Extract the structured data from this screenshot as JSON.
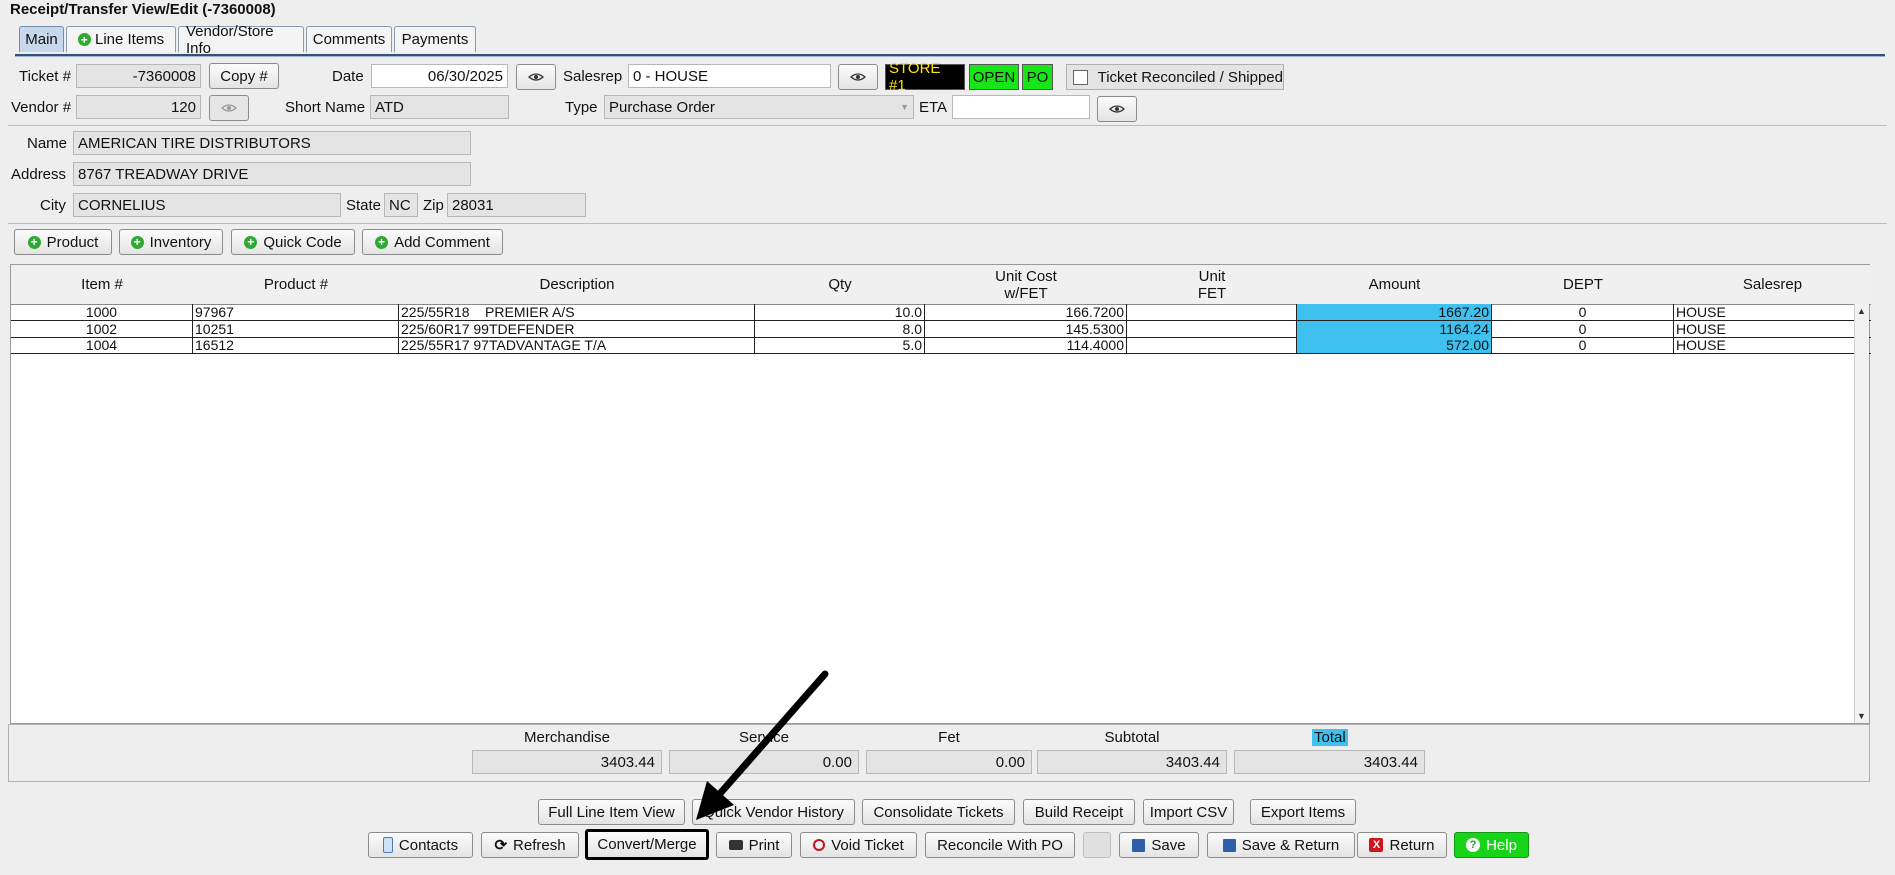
{
  "window": {
    "title": "Receipt/Transfer View/Edit  (-7360008)"
  },
  "tabs": [
    {
      "label": "Main",
      "active": true
    },
    {
      "label": "Line Items"
    },
    {
      "label": "Vendor/Store Info"
    },
    {
      "label": "Comments"
    },
    {
      "label": "Payments"
    }
  ],
  "header": {
    "ticket_label": "Ticket #",
    "ticket_value": "-7360008",
    "copy_button": "Copy #",
    "date_label": "Date",
    "date_value": "06/30/2025",
    "salesrep_label": "Salesrep",
    "salesrep_value": "0 - HOUSE",
    "badges": {
      "store": "STORE #1",
      "open": "OPEN",
      "po": "PO"
    },
    "reconciled_label": "Ticket Reconciled / Shipped",
    "vendor_label": "Vendor #",
    "vendor_value": "120",
    "shortname_label": "Short Name",
    "shortname_value": "ATD",
    "type_label": "Type",
    "type_value": "Purchase Order",
    "eta_label": "ETA",
    "eta_value": ""
  },
  "vendor": {
    "name_label": "Name",
    "name_value": "AMERICAN TIRE DISTRIBUTORS",
    "address_label": "Address",
    "address_value": "8767 TREADWAY DRIVE",
    "city_label": "City",
    "city_value": "CORNELIUS",
    "state_label": "State",
    "state_value": "NC",
    "zip_label": "Zip",
    "zip_value": "28031"
  },
  "add_buttons": {
    "product": "Product",
    "inventory": "Inventory",
    "quick_code": "Quick Code",
    "add_comment": "Add Comment"
  },
  "table": {
    "headers": {
      "item": "Item #",
      "product": "Product #",
      "description": "Description",
      "qty": "Qty",
      "unit_cost": "Unit Cost\nw/FET",
      "unit_fet": "Unit\nFET",
      "amount": "Amount",
      "dept": "DEPT",
      "salesrep": "Salesrep"
    },
    "rows": [
      {
        "item": "1000",
        "product": "97967",
        "description": "225/55R18    PREMIER A/S",
        "qty": "10.0",
        "unit_cost": "166.7200",
        "unit_fet": "",
        "amount": "1667.20",
        "dept": "0",
        "salesrep": "HOUSE"
      },
      {
        "item": "1002",
        "product": "10251",
        "description": "225/60R17 99TDEFENDER",
        "qty": "8.0",
        "unit_cost": "145.5300",
        "unit_fet": "",
        "amount": "1164.24",
        "dept": "0",
        "salesrep": "HOUSE"
      },
      {
        "item": "1004",
        "product": "16512",
        "description": "225/55R17 97TADVANTAGE T/A",
        "qty": "5.0",
        "unit_cost": "114.4000",
        "unit_fet": "",
        "amount": "572.00",
        "dept": "0",
        "salesrep": "HOUSE"
      }
    ]
  },
  "totals": {
    "merchandise_label": "Merchandise",
    "merchandise_value": "3403.44",
    "service_label": "Service",
    "service_value": "0.00",
    "fet_label": "Fet",
    "fet_value": "0.00",
    "subtotal_label": "Subtotal",
    "subtotal_value": "3403.44",
    "total_label": "Total",
    "total_value": "3403.44"
  },
  "actions_row1": {
    "full_line": "Full Line Item View",
    "quick_vendor": "Quick Vendor History",
    "consolidate": "Consolidate Tickets",
    "build_receipt": "Build Receipt",
    "import_csv": "Import CSV",
    "export_items": "Export Items"
  },
  "actions_row2": {
    "contacts": "Contacts",
    "refresh": "Refresh",
    "convert_merge": "Convert/Merge",
    "print": "Print",
    "void_ticket": "Void Ticket",
    "reconcile_po": "Reconcile With PO",
    "save": "Save",
    "save_return": "Save & Return",
    "return": "Return",
    "help": "Help"
  },
  "colors": {
    "accent_amount": "#3ec1ee",
    "badge_green": "#19e619",
    "help_green": "#18d418",
    "store_badge_bg": "#000000",
    "store_badge_fg": "#ffe600"
  }
}
